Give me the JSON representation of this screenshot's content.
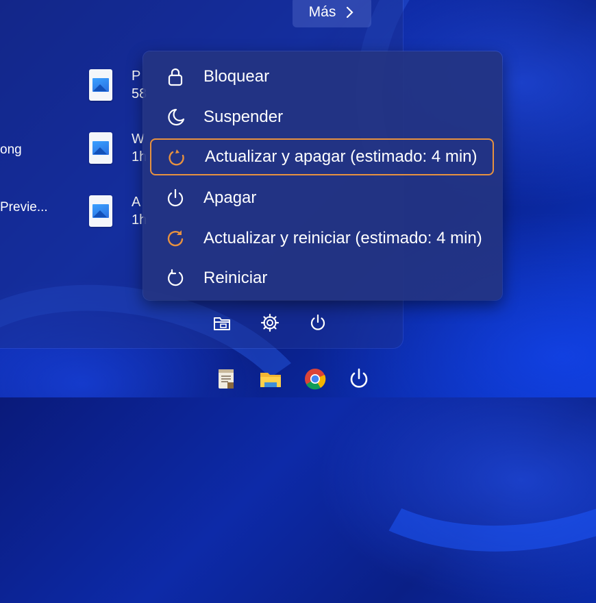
{
  "start_panel": {
    "more_button": {
      "label": "Más",
      "chevron": "chevron-right-icon"
    },
    "recommended": [
      {
        "name": "P",
        "detail": "58"
      },
      {
        "name": "W",
        "detail": "1h"
      },
      {
        "name": "A",
        "detail": "1h"
      }
    ],
    "left_cut_texts": [
      "ong",
      "Previe..."
    ],
    "footer_icons": [
      "file-explorer-icon",
      "settings-gear-icon",
      "power-icon"
    ]
  },
  "power_menu": {
    "items": [
      {
        "label": "Bloquear",
        "icon": "lock-icon",
        "highlight": false
      },
      {
        "label": "Suspender",
        "icon": "moon-icon",
        "highlight": false
      },
      {
        "label": "Actualizar y apagar (estimado: 4 min)",
        "icon": "update-shutdown-icon",
        "highlight": true,
        "accent": "#e8923f"
      },
      {
        "label": "Apagar",
        "icon": "power-icon",
        "highlight": false
      },
      {
        "label": "Actualizar y reiniciar (estimado: 4 min)",
        "icon": "update-restart-icon",
        "highlight": false,
        "accent": "#e8923f"
      },
      {
        "label": "Reiniciar",
        "icon": "restart-icon",
        "highlight": false
      }
    ]
  },
  "taskbar": {
    "icons": [
      "notepad-icon",
      "folder-icon",
      "chrome-icon",
      "power-icon"
    ]
  },
  "colors": {
    "accent_orange": "#e8923f",
    "menu_bg": "#243482"
  }
}
